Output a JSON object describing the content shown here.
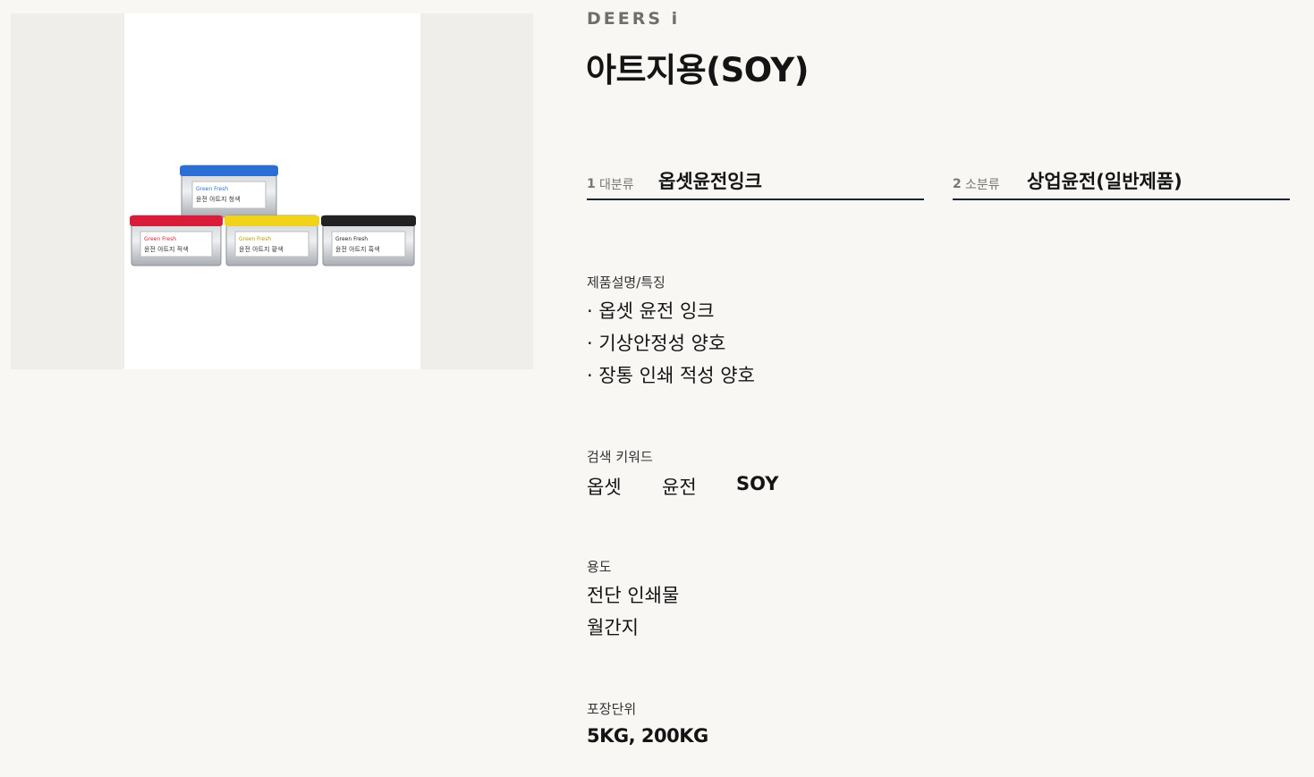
{
  "brand": "DEERS i",
  "product": {
    "title": "아트지용(SOY)",
    "image_labels": [
      "Green Fresh",
      "윤전 아트지 청색",
      "윤전 아트지 적색",
      "윤전 아트지 황색",
      "윤전 아트지 흑색"
    ]
  },
  "categories": [
    {
      "num": "1",
      "label": "대분류",
      "value": "옵셋윤전잉크"
    },
    {
      "num": "2",
      "label": "소분류",
      "value": "상업윤전(일반제품)"
    }
  ],
  "features": {
    "label": "제품설명/특징",
    "items": [
      "· 옵셋 윤전 잉크",
      "· 기상안정성 양호",
      "· 장통 인쇄 적성 양호"
    ]
  },
  "keywords": {
    "label": "검색 키워드",
    "items": [
      "옵셋",
      "윤전",
      "SOY"
    ]
  },
  "usage": {
    "label": "용도",
    "items": [
      "전단 인쇄물",
      "월간지"
    ]
  },
  "packaging": {
    "label": "포장단위",
    "value": "5KG, 200KG"
  },
  "colors": {
    "background": "#f8f7f4",
    "image_bg": "#efeeea",
    "underline": "#1d2233",
    "can_blue": "#2b6fd6",
    "can_red": "#d91c3a",
    "can_yellow": "#f1d31a",
    "can_black": "#222222"
  }
}
